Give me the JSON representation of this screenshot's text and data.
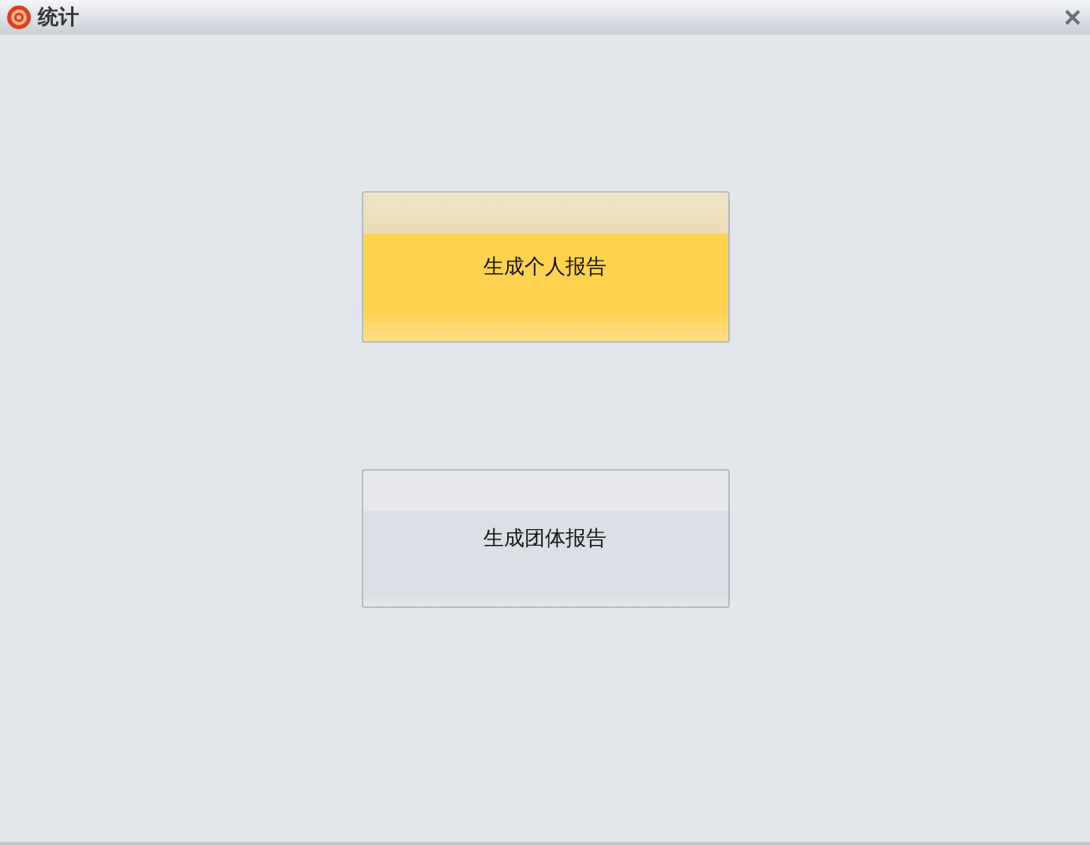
{
  "window": {
    "title": "统计"
  },
  "buttons": [
    {
      "label": "生成个人报告",
      "highlighted": true
    },
    {
      "label": "生成团体报告",
      "highlighted": false
    }
  ]
}
